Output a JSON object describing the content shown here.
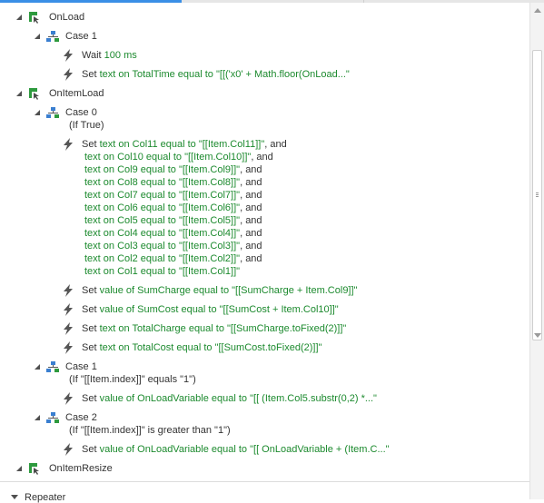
{
  "events": [
    {
      "label": "OnLoad",
      "cases": [
        {
          "label": "Case 1",
          "condition": "",
          "actions": [
            {
              "lines": [
                [
                  {
                    "t": "Wait ",
                    "c": "dk"
                  },
                  {
                    "t": "100 ms",
                    "c": "gr"
                  }
                ]
              ]
            },
            {
              "lines": [
                [
                  {
                    "t": "Set ",
                    "c": "dk"
                  },
                  {
                    "t": "text on TotalTime equal to \"[[('x0' + Math.floor(OnLoad...\"",
                    "c": "gr"
                  }
                ]
              ]
            }
          ]
        }
      ]
    },
    {
      "label": "OnItemLoad",
      "cases": [
        {
          "label": "Case 0",
          "condition": "(If True)",
          "actions": [
            {
              "lines": [
                [
                  {
                    "t": "Set ",
                    "c": "dk"
                  },
                  {
                    "t": "text on Col11 equal to \"[[Item.Col11]]\"",
                    "c": "gr"
                  },
                  {
                    "t": ", and",
                    "c": "dk"
                  }
                ],
                [
                  {
                    "t": "text on Col10 equal to \"[[Item.Col10]]\"",
                    "c": "gr"
                  },
                  {
                    "t": ", and",
                    "c": "dk"
                  }
                ],
                [
                  {
                    "t": "text on Col9 equal to \"[[Item.Col9]]\"",
                    "c": "gr"
                  },
                  {
                    "t": ", and",
                    "c": "dk"
                  }
                ],
                [
                  {
                    "t": "text on Col8 equal to \"[[Item.Col8]]\"",
                    "c": "gr"
                  },
                  {
                    "t": ", and",
                    "c": "dk"
                  }
                ],
                [
                  {
                    "t": "text on Col7 equal to \"[[Item.Col7]]\"",
                    "c": "gr"
                  },
                  {
                    "t": ", and",
                    "c": "dk"
                  }
                ],
                [
                  {
                    "t": "text on Col6 equal to \"[[Item.Col6]]\"",
                    "c": "gr"
                  },
                  {
                    "t": ", and",
                    "c": "dk"
                  }
                ],
                [
                  {
                    "t": "text on Col5 equal to \"[[Item.Col5]]\"",
                    "c": "gr"
                  },
                  {
                    "t": ", and",
                    "c": "dk"
                  }
                ],
                [
                  {
                    "t": "text on Col4 equal to \"[[Item.Col4]]\"",
                    "c": "gr"
                  },
                  {
                    "t": ", and",
                    "c": "dk"
                  }
                ],
                [
                  {
                    "t": "text on Col3 equal to \"[[Item.Col3]]\"",
                    "c": "gr"
                  },
                  {
                    "t": ", and",
                    "c": "dk"
                  }
                ],
                [
                  {
                    "t": "text on Col2 equal to \"[[Item.Col2]]\"",
                    "c": "gr"
                  },
                  {
                    "t": ", and",
                    "c": "dk"
                  }
                ],
                [
                  {
                    "t": "text on Col1 equal to \"[[Item.Col1]]\"",
                    "c": "gr"
                  }
                ]
              ]
            },
            {
              "lines": [
                [
                  {
                    "t": "Set ",
                    "c": "dk"
                  },
                  {
                    "t": "value of SumCharge equal to \"[[SumCharge + Item.Col9]]\"",
                    "c": "gr"
                  }
                ]
              ]
            },
            {
              "lines": [
                [
                  {
                    "t": "Set ",
                    "c": "dk"
                  },
                  {
                    "t": "value of SumCost equal to \"[[SumCost + Item.Col10]]\"",
                    "c": "gr"
                  }
                ]
              ]
            },
            {
              "lines": [
                [
                  {
                    "t": "Set ",
                    "c": "dk"
                  },
                  {
                    "t": "text on TotalCharge equal to \"[[SumCharge.toFixed(2)]]\"",
                    "c": "gr"
                  }
                ]
              ]
            },
            {
              "lines": [
                [
                  {
                    "t": "Set ",
                    "c": "dk"
                  },
                  {
                    "t": "text on TotalCost equal to \"[[SumCost.toFixed(2)]]\"",
                    "c": "gr"
                  }
                ]
              ]
            }
          ]
        },
        {
          "label": "Case 1",
          "condition": "(If \"[[Item.index]]\" equals \"1\")",
          "actions": [
            {
              "lines": [
                [
                  {
                    "t": "Set ",
                    "c": "dk"
                  },
                  {
                    "t": "value of OnLoadVariable equal to \"[[ (Item.Col5.substr(0,2) *...\"",
                    "c": "gr"
                  }
                ]
              ]
            }
          ]
        },
        {
          "label": "Case 2",
          "condition": "(If \"[[Item.index]]\" is greater than \"1\")",
          "actions": [
            {
              "lines": [
                [
                  {
                    "t": "Set ",
                    "c": "dk"
                  },
                  {
                    "t": "value of OnLoadVariable equal to \"[[ OnLoadVariable + (Item.C...\"",
                    "c": "gr"
                  }
                ]
              ]
            }
          ]
        }
      ]
    },
    {
      "label": "OnItemResize",
      "cases": []
    }
  ],
  "footer": {
    "label": "Repeater"
  },
  "colors": {
    "action_text": "#1c8a2e",
    "plain_text": "#333333",
    "event_icon": "#2e9a3e",
    "case_icon": "#3a7fd0",
    "bolt_icon": "#555555"
  }
}
